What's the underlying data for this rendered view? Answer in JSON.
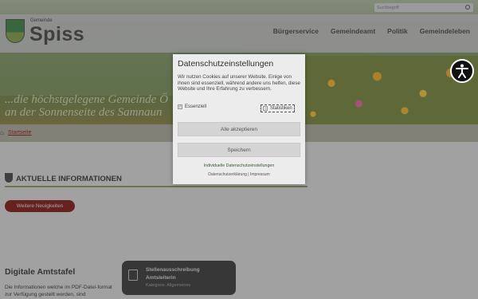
{
  "header": {
    "logo_small": "Gemeinde",
    "logo_big": "Spiss",
    "nav": [
      "Bürgerservice",
      "Gemeindeamt",
      "Politik",
      "Gemeindeleben"
    ]
  },
  "search": {
    "placeholder": "Suchbegriff"
  },
  "hero": {
    "tagline_line1": "...die höchstgelegene Gemeinde Ö",
    "tagline_line2": "an der Sonnenseite des Samnaun"
  },
  "breadcrumb": {
    "home_label": "Startseite"
  },
  "news": {
    "section_title": "AKTUELLE INFORMATIONEN",
    "more_button": "Weitere Neuigkeiten"
  },
  "amtstafel": {
    "title": "Digitale Amtstafel",
    "text": "Die Informationen welche im PDF-Datei-format zur Verfügung gestellt werden, sind"
  },
  "job_card": {
    "title_line1": "Stellenausschreibung",
    "title_line2": "Amtsleiterin",
    "category": "Kategorie: Allgemeines"
  },
  "consent": {
    "title": "Datenschutzeinstellungen",
    "text": "Wir nutzen Cookies auf unserer Website. Einige von ihnen sind essenziell, während andere uns helfen, diese Website und Ihre Erfahrung zu verbessern.",
    "option_essential": "Essenziell",
    "option_statistics": "Statistiken",
    "accept_all": "Alle akzeptieren",
    "save": "Speichern",
    "individual_link": "Individuelle Datenschutzeinstellungen",
    "privacy_link": "Datenschutzerklärung",
    "separator": " | ",
    "imprint_link": "Impressum"
  },
  "colors": {
    "brand_red": "#7a0a0a",
    "crumb_link": "#8a1010"
  }
}
